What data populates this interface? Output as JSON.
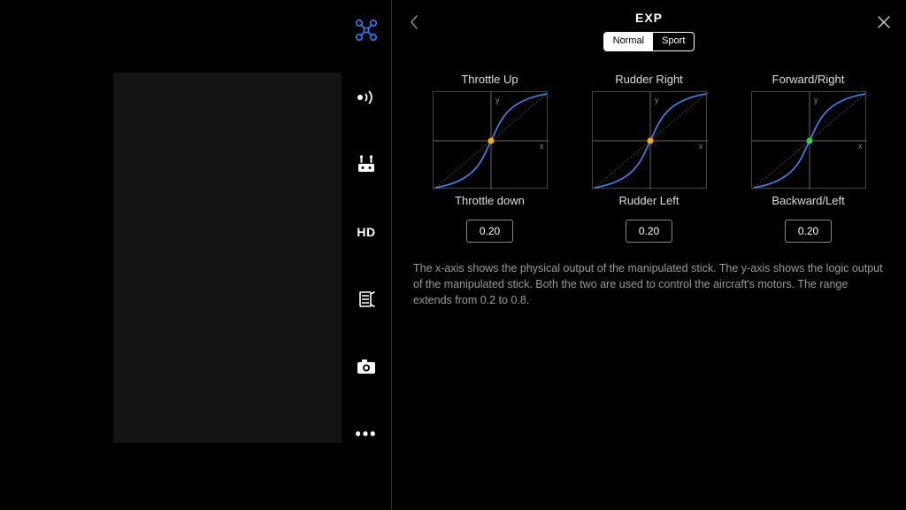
{
  "panel": {
    "title": "EXP",
    "tabs": {
      "normal": "Normal",
      "sport": "Sport"
    },
    "description": "The x-axis shows the physical output of the manipulated stick. The y-axis shows the logic output of the manipulated stick. Both the two are used to control the aircraft's motors. The range extends from 0.2 to 0.8."
  },
  "curves": [
    {
      "top_label": "Throttle Up",
      "bottom_label": "Throttle down",
      "value": "0.20",
      "center_color": "#ffaa00"
    },
    {
      "top_label": "Rudder Right",
      "bottom_label": "Rudder Left",
      "value": "0.20",
      "center_color": "#ffaa00"
    },
    {
      "top_label": "Forward/Right",
      "bottom_label": "Backward/Left",
      "value": "0.20",
      "center_color": "#2fcf4f"
    }
  ],
  "axis": {
    "x": "x",
    "y": "y"
  },
  "sidebar": {
    "items": [
      "aircraft",
      "signal",
      "remote",
      "hd",
      "gimbal",
      "camera",
      "more"
    ],
    "hd_label": "HD"
  },
  "colors": {
    "accent": "#2b7fff",
    "curve": "#3d8bff",
    "grid": "#555555"
  }
}
